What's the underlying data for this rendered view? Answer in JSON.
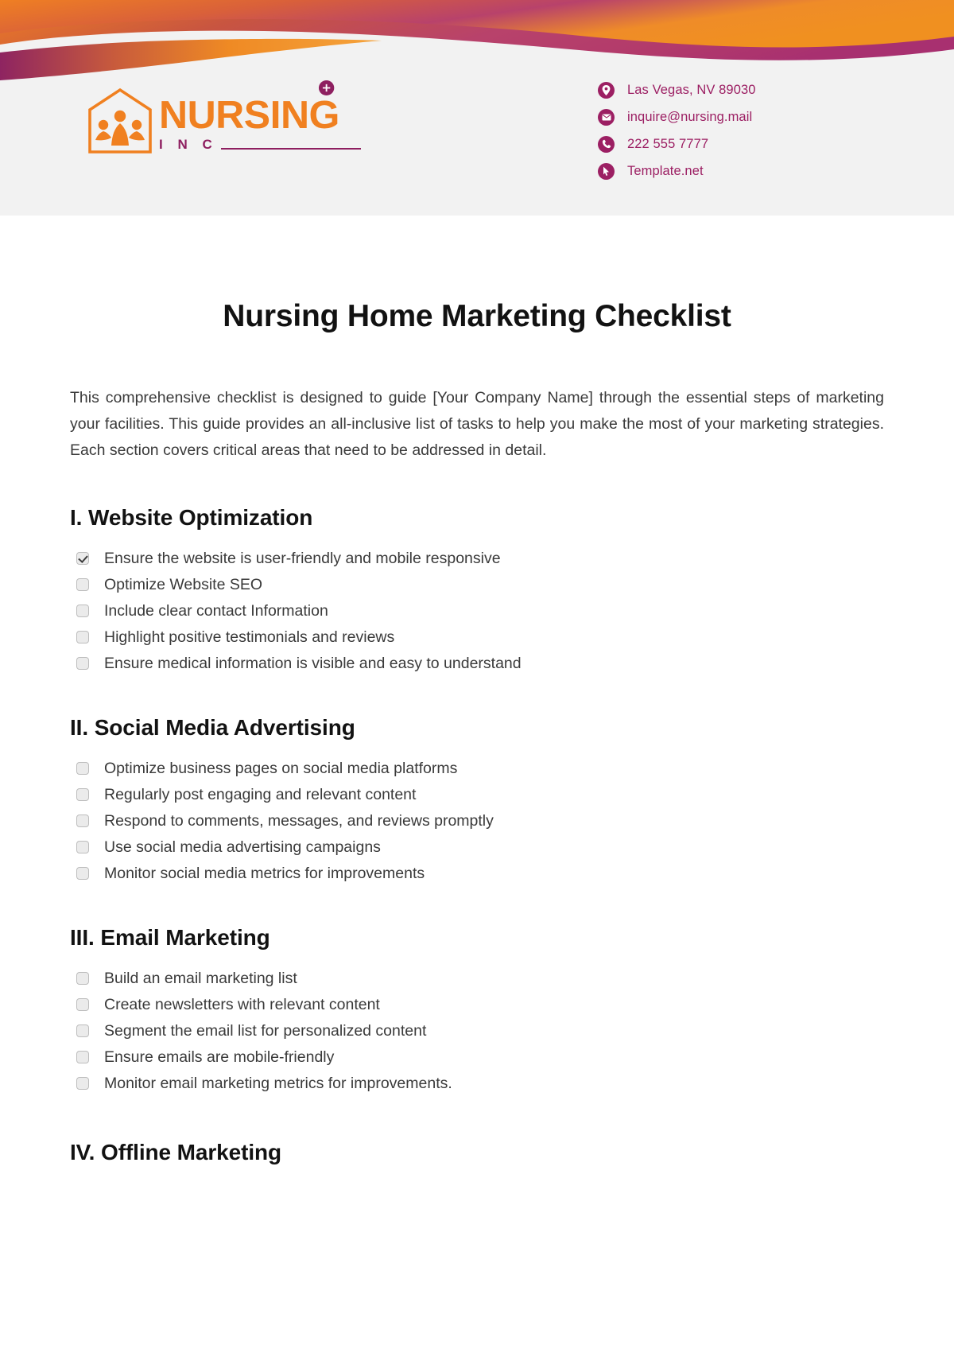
{
  "brand": {
    "logo_name": "NURSING",
    "logo_sub": "I N C",
    "logo_orange": "#f08020",
    "logo_magenta": "#8e1f60"
  },
  "contact": {
    "items": [
      {
        "icon": "location-pin-icon",
        "text": "Las Vegas, NV 89030"
      },
      {
        "icon": "envelope-icon",
        "text": "inquire@nursing.mail"
      },
      {
        "icon": "phone-icon",
        "text": "222 555 7777"
      },
      {
        "icon": "cursor-arrow-icon",
        "text": "Template.net"
      }
    ],
    "accent_color": "#9c1f63"
  },
  "document": {
    "title": "Nursing Home Marketing Checklist",
    "intro": "This comprehensive checklist is designed to guide [Your Company Name] through the essential steps of marketing your facilities. This guide provides an all-inclusive list of tasks to help you make the most of your marketing strategies. Each section covers critical areas that need to be addressed in detail."
  },
  "sections": [
    {
      "heading": "I. Website Optimization",
      "items": [
        {
          "label": "Ensure the website is user-friendly and mobile responsive",
          "checked": true
        },
        {
          "label": "Optimize Website SEO",
          "checked": false
        },
        {
          "label": "Include clear contact Information",
          "checked": false
        },
        {
          "label": "Highlight positive testimonials and reviews",
          "checked": false
        },
        {
          "label": "Ensure medical information is visible and easy to understand",
          "checked": false
        }
      ]
    },
    {
      "heading": "II. Social Media Advertising",
      "items": [
        {
          "label": "Optimize business pages on social media platforms",
          "checked": false
        },
        {
          "label": "Regularly post engaging and relevant content",
          "checked": false
        },
        {
          "label": "Respond to comments, messages, and reviews promptly",
          "checked": false
        },
        {
          "label": "Use social media advertising campaigns",
          "checked": false
        },
        {
          "label": "Monitor social media metrics for improvements",
          "checked": false
        }
      ]
    },
    {
      "heading": "III. Email Marketing",
      "items": [
        {
          "label": "Build an email marketing list",
          "checked": false
        },
        {
          "label": "Create newsletters with relevant content",
          "checked": false
        },
        {
          "label": "Segment the email list for personalized content",
          "checked": false
        },
        {
          "label": "Ensure emails are mobile-friendly",
          "checked": false
        },
        {
          "label": "Monitor email marketing metrics for improvements.",
          "checked": false
        }
      ]
    },
    {
      "heading": "IV. Offline Marketing",
      "items": []
    }
  ]
}
